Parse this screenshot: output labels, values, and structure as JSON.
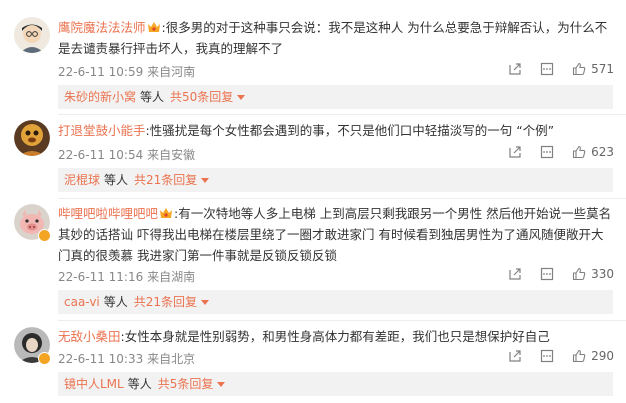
{
  "comments": [
    {
      "name": "鹰院魔法法法师",
      "text": ":很多男的对于这种事只会说：我不是这种人 为什么总要急于辩解否认，为什么不是去谴责暴行抨击坏人，我真的理解不了",
      "date": "22-6-11 10:59",
      "location": "来自河南",
      "likes": "571",
      "reply": {
        "name": "朱砂的新小窝",
        "tail": "等人",
        "total": "共50条回复"
      }
    },
    {
      "name": "打退堂鼓小能手",
      "text": ":性骚扰是每个女性都会遇到的事，不只是他们口中轻描淡写的一句 “个例”",
      "date": "22-6-11 10:54",
      "location": "来自安徽",
      "likes": "623",
      "reply": {
        "name": "泥棍球",
        "tail": "等人",
        "total": "共21条回复"
      }
    },
    {
      "name": "哔哩吧啦哔哩吧吧",
      "text": ":有一次特地等人多上电梯 上到高层只剩我跟另一个男性 然后他开始说一些莫名其妙的话搭讪 吓得我出电梯在楼层里绕了一圈才敢进家门 有时候看到独居男性为了通风随便敞开大门真的很羡慕 我进家门第一件事就是反锁反锁反锁",
      "date": "22-6-11 11:16",
      "location": "来自湖南",
      "likes": "330",
      "reply": {
        "name": "caa-vi",
        "tail": "等人",
        "total": "共21条回复"
      }
    },
    {
      "name": "无敌小桑田",
      "text": ":女性本身就是性别弱势，和男性身高体力都有差距，我们也只是想保护好自己",
      "date": "22-6-11 10:33",
      "location": "来自北京",
      "likes": "290",
      "reply": {
        "name": "镜中人LML",
        "tail": "等人",
        "total": "共5条回复"
      }
    }
  ]
}
